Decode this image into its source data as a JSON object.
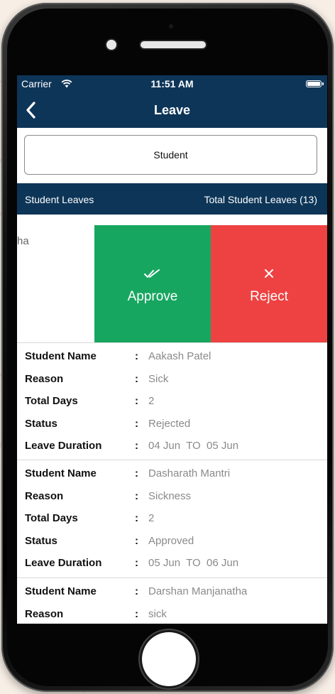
{
  "status_bar": {
    "carrier": "Carrier",
    "time": "11:51 AM"
  },
  "nav": {
    "title": "Leave"
  },
  "selector": {
    "value": "Student"
  },
  "section": {
    "left_label": "Student Leaves",
    "right_label": "Total Student Leaves (13)"
  },
  "swipe_row": {
    "peek_text": "ha",
    "approve_label": "Approve",
    "reject_label": "Reject"
  },
  "labels": {
    "student_name": "Student Name",
    "reason": "Reason",
    "total_days": "Total Days",
    "status": "Status",
    "leave_duration": "Leave Duration",
    "colon": ":"
  },
  "records": [
    {
      "student_name": "Aakash Patel",
      "reason": "Sick",
      "total_days": "2",
      "status": "Rejected",
      "leave_duration": "04 Jun  TO  05 Jun"
    },
    {
      "student_name": "Dasharath Mantri",
      "reason": "Sickness",
      "total_days": "2",
      "status": "Approved",
      "leave_duration": "05 Jun  TO  06 Jun"
    },
    {
      "student_name": "Darshan Manjanatha",
      "reason": "sick"
    }
  ],
  "colors": {
    "nav_bg": "#0d3558",
    "approve": "#17a660",
    "reject": "#ee4242",
    "value_text": "#8a8a8a"
  },
  "icons": [
    "wifi-icon",
    "battery-icon",
    "back-chevron-icon",
    "double-check-icon",
    "close-icon"
  ]
}
